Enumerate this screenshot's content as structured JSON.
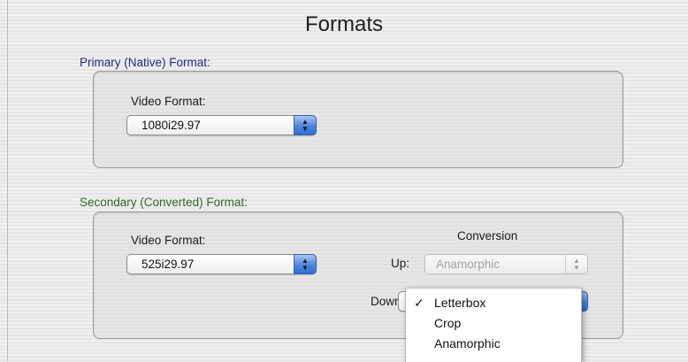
{
  "title": "Formats",
  "primary": {
    "section_label": "Primary (Native) Format:",
    "video_format_label": "Video Format:",
    "video_format_value": "1080i29.97"
  },
  "secondary": {
    "section_label": "Secondary (Converted) Format:",
    "video_format_label": "Video Format:",
    "video_format_value": "525i29.97",
    "conversion_heading": "Conversion",
    "up_label": "Up:",
    "up_value": "Anamorphic",
    "down_label": "Down:",
    "down_label_visible": "Down"
  },
  "down_menu": {
    "checkmark": "✓",
    "items": [
      "Letterbox",
      "Crop",
      "Anamorphic"
    ],
    "selected": "Letterbox"
  },
  "icons": {
    "stepper_up": "▲",
    "stepper_down": "▼"
  }
}
